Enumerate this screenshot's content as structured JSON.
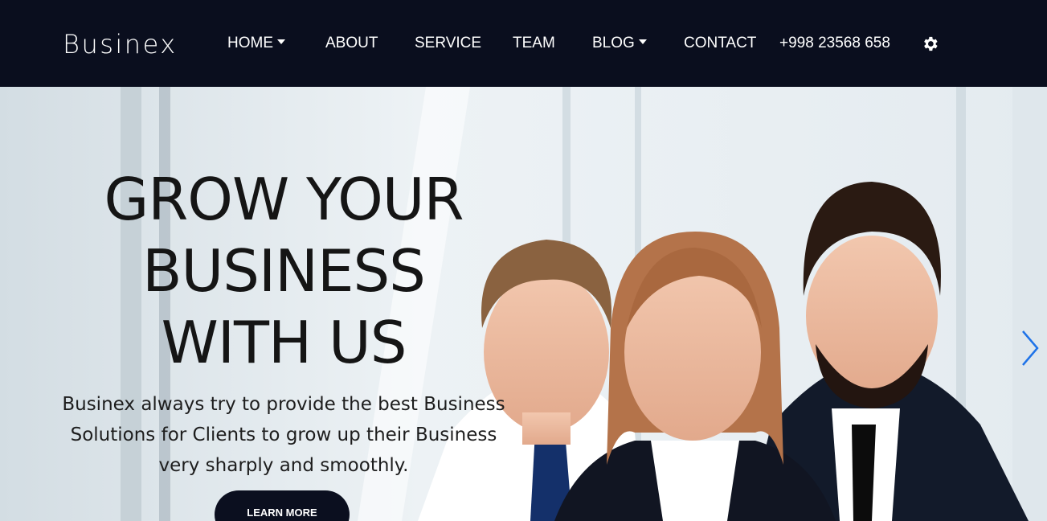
{
  "brand": {
    "name": "Businex"
  },
  "nav": {
    "home": "HOME",
    "about": "ABOUT",
    "service": "SERVICE",
    "team": "TEAM",
    "blog": "BLOG",
    "contact": "CONTACT",
    "phone": "+998 23568 658",
    "settings_icon": "gear-icon"
  },
  "hero": {
    "headline_line1": "GROW YOUR",
    "headline_line2": "BUSINESS",
    "headline_line3": "WITH US",
    "subtext_line1": "Businex always try to provide the best Business",
    "subtext_line2": "Solutions for Clients to grow up their Business",
    "subtext_line3": "very sharply and smoothly.",
    "cta_label": "LEARN MORE",
    "next_icon": "chevron-right-icon"
  },
  "colors": {
    "header_bg": "#0a0e1e",
    "cta_bg": "#0b0f1f",
    "arrow": "#1e73e8"
  }
}
